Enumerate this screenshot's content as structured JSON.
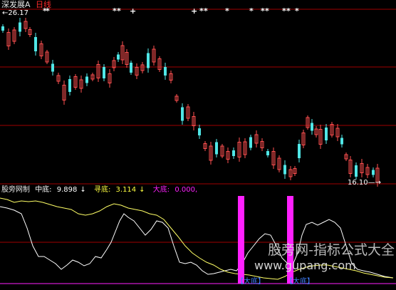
{
  "header": {
    "stock_name": "深发展A",
    "period": "日线",
    "colors": {
      "stock_name": "#e6e6e6",
      "period": "#ff2a2a"
    }
  },
  "price_panel": {
    "high_marker": "26.17",
    "low_marker": "16.10",
    "star_glyph": "*",
    "cross_glyph": "+",
    "colors": {
      "up_candle": "#ff5050",
      "down_candle": "#50e6e6",
      "grid": "#a00000",
      "marker": "#ffffff"
    }
  },
  "indicator_panel": {
    "name": "股旁网制",
    "items": [
      {
        "label": "中底:",
        "value": "9.898",
        "arrow": "↓",
        "color": "#ffffff"
      },
      {
        "label": "寻底:",
        "value": "3.114",
        "arrow": "↓",
        "color": "#ffff40"
      },
      {
        "label": "大底:",
        "value": "0.000,",
        "arrow": "",
        "color": "#ff20ff"
      }
    ],
    "signal_label": "大底",
    "colors": {
      "name": "#e6e6e6",
      "white_line": "#ffffff",
      "yellow_line": "#ffff66",
      "signal_bar": "#ff20ff",
      "signal_text": "#4080ff"
    }
  },
  "watermark": {
    "text": "股旁网-指标公式大全",
    "url": "www.gupang.com"
  }
}
